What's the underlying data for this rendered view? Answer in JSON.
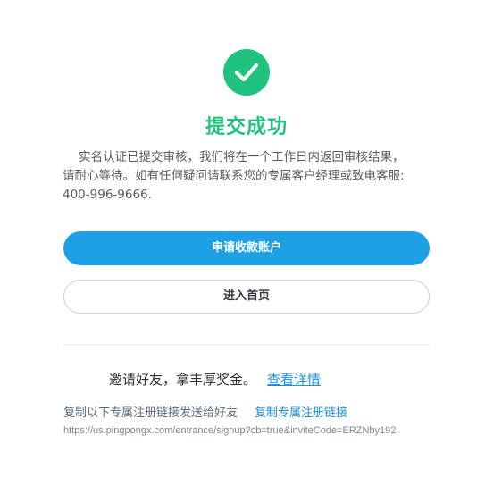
{
  "status": {
    "icon": "check-circle-icon",
    "title": "提交成功",
    "description_lines": [
      "实名认证已提交审核，我们将在一个工作日内返回审核结果，",
      "请耐心等待。如有任何疑问请联系您的专属客户经理或致电客服:",
      "400-996-9666."
    ]
  },
  "actions": {
    "primary_label": "申请收款账户",
    "secondary_label": "进入首页"
  },
  "invite": {
    "text": "邀请好友，拿丰厚奖金。",
    "details_link": "查看详情",
    "copy_prompt": "复制以下专属注册链接发送给好友",
    "copy_link": "复制专属注册链接",
    "url": "https://us.pingpongx.com/entrance/signup?cb=true&inviteCode=ERZNby192"
  },
  "colors": {
    "success": "#21c27f",
    "primary": "#1ea0e6",
    "link": "#1e8ed8"
  }
}
